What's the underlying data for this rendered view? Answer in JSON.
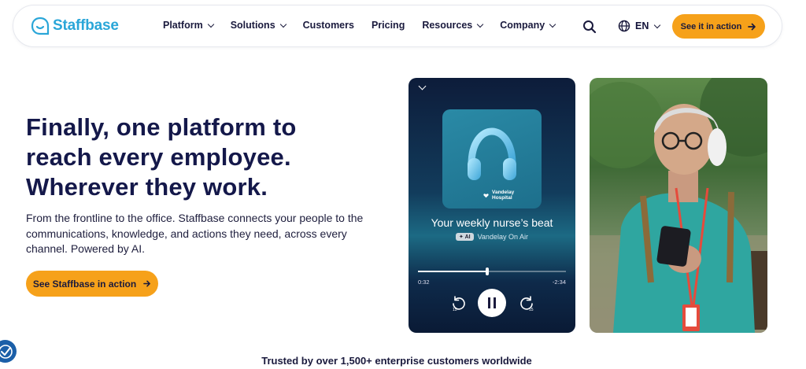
{
  "brand": {
    "name": "Staffbase",
    "color": "#2aa6d8"
  },
  "nav": {
    "items": [
      {
        "label": "Platform",
        "dropdown": true
      },
      {
        "label": "Solutions",
        "dropdown": true
      },
      {
        "label": "Customers",
        "dropdown": false
      },
      {
        "label": "Pricing",
        "dropdown": false
      },
      {
        "label": "Resources",
        "dropdown": true
      },
      {
        "label": "Company",
        "dropdown": true
      }
    ],
    "search_icon": "search-icon",
    "language": "EN",
    "cta_label": "See it in action"
  },
  "hero": {
    "title_lines": [
      "Finally, one platform to",
      "reach every employee.",
      "Wherever they work."
    ],
    "subtitle": "From the frontline to the office. Staffbase connects your people to the communications, knowledge, and actions they need, across every channel. Powered by AI.",
    "cta_label": "See Staffbase in action"
  },
  "player": {
    "cover_brand": "Vandelay Hospital",
    "track_title": "Your weekly nurse’s beat",
    "ai_badge": "AI",
    "show_name": "Vandelay On Air",
    "progress": 0.47,
    "elapsed": "0:32",
    "remaining": "-2:34",
    "skip_back": "15",
    "skip_forward": "15"
  },
  "trusted_text": "Trusted by over 1,500+ enterprise customers worldwide",
  "colors": {
    "accent": "#f6a11a",
    "heading": "#14184a"
  }
}
